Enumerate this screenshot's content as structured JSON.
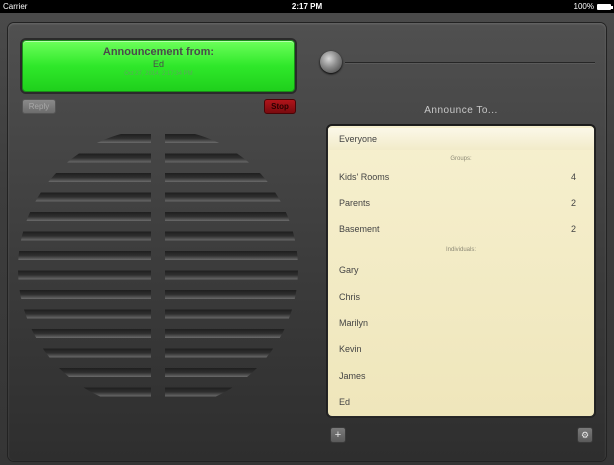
{
  "status_bar": {
    "carrier": "Carrier",
    "time": "2:17 PM",
    "battery": "100%"
  },
  "announcement": {
    "title": "Announcement from:",
    "sender": "Ed",
    "timestamp": "Oct 27, 2014, 2:17:34 PM",
    "color": "#2fe82a"
  },
  "buttons": {
    "reply": "Reply",
    "stop": "Stop",
    "add": "+",
    "settings": "⚙"
  },
  "announce_to": {
    "heading": "Announce To...",
    "everyone": "Everyone",
    "groups_header": "Groups:",
    "groups": [
      {
        "name": "Kids' Rooms",
        "count": "4"
      },
      {
        "name": "Parents",
        "count": "2"
      },
      {
        "name": "Basement",
        "count": "2"
      }
    ],
    "individuals_header": "Individuals:",
    "individuals": [
      "Gary",
      "Chris",
      "Marilyn",
      "Kevin",
      "James",
      "Ed"
    ]
  },
  "colors": {
    "list_background": "#f3ecc6",
    "stop_button": "#b0141a"
  }
}
